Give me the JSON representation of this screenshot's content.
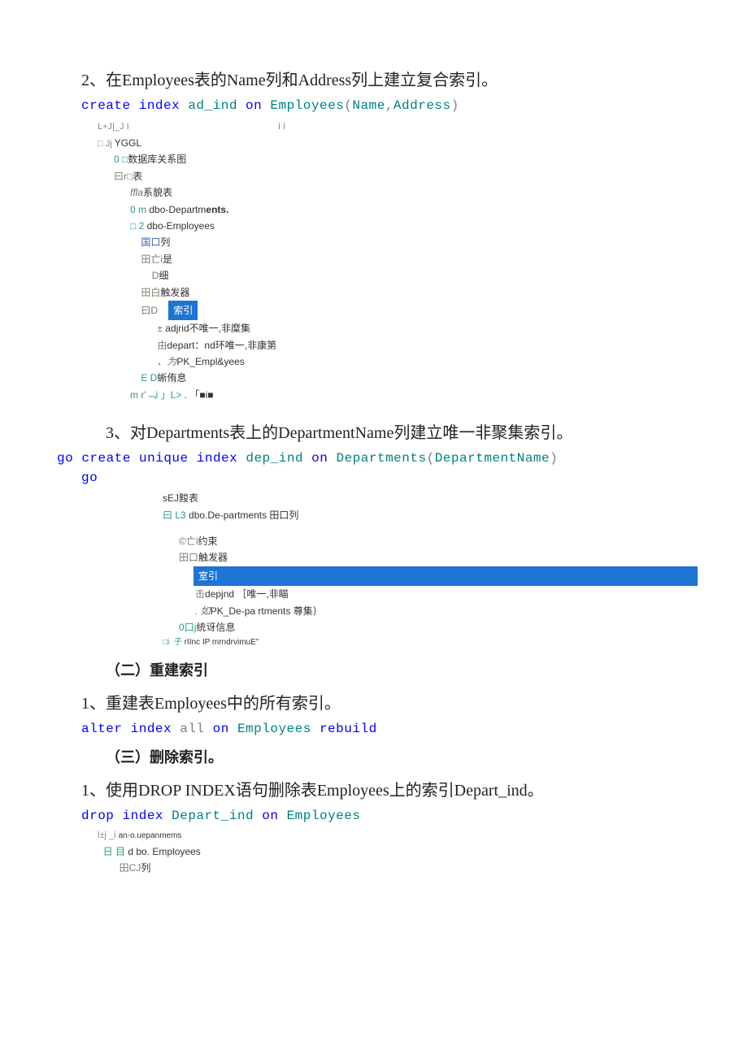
{
  "s2": {
    "title": "2、在Employees表的Name列和Address列上建立复合索引。",
    "code": {
      "create": "create index ",
      "idx": "ad_ind ",
      "on": "on ",
      "tbl": "Employees",
      "open": "(",
      "c1": "Name",
      "comma": ",",
      "c2": "Address",
      "close": ")"
    },
    "tree": {
      "r0": "L+J|_J I",
      "r0b": "I I",
      "r1_prefix": "□ Jj ",
      "r1": "YGGL",
      "r2_prefix": "0 □",
      "r2": "数据库关系图",
      "r3_prefix": "曰r□",
      "r3": "表",
      "r4_prefix": "fflа",
      "r4": "系貌表",
      "r5_prefix": "0 m ",
      "r5": "dbo-Departm",
      "r5b": "ents.",
      "r6_prefix": "□ 2 ",
      "r6": "dbo-Employees",
      "r7_prefix": "国口",
      "r7": "列",
      "r8_prefix": "田亡і",
      "r8": "是",
      "r9_prefix": "D",
      "r9": "细",
      "r10_prefix": "田白",
      "r10": "触发器",
      "r11_prefix": "曰D",
      "r11": "索引",
      "r12_prefix": "± ",
      "r12": "adjrid不唯一,非糜集",
      "r13_prefix": "由",
      "r13": "depart：nd环唯一,非康第",
      "r14_prefix": "、为",
      "r14": "PK_Empl&yees",
      "r15_prefix": "E D",
      "r15": "蜥侑息",
      "r16_prefix": "m r'﹁і 」L>",
      "r16": " . 「■і■"
    }
  },
  "s3": {
    "title": "3、对Departments表上的DepartmentName列建立唯一非聚集索引。",
    "code": {
      "go1": "go ",
      "create": "create unique index ",
      "idx": "dep_ind ",
      "on": "on ",
      "tbl": "Departments",
      "open": "(",
      "c1": "DepartmentName",
      "close": ")",
      "go2": "go"
    },
    "tree": {
      "r1": "sEJ黢表",
      "r2_prefix": "曰 L3 ",
      "r2": "dbo.De-partments 田口列",
      "r3_prefix": "©亡i",
      "r3": "约束",
      "r4_prefix": "田口",
      "r4": "触发器",
      "r5": "室引",
      "r6_prefix": "击",
      "r6": "depjnd ［唯一,非瞄",
      "r7_prefix": ". 如",
      "r7": "PK_De-pa rtments 尊集）",
      "r8_prefix": "0口j",
      "r8": "统讶信息",
      "r9_prefix": "□i  子",
      "r9": " rIInc IP mrndrvimuE\""
    }
  },
  "ssRebuild": {
    "heading": "（二）重建索引",
    "title": "1、重建表Employees中的所有索引。",
    "code": {
      "alter": "alter index ",
      "all": "all ",
      "on": "on ",
      "tbl": "Employees ",
      "rebuild": "rebuild"
    }
  },
  "ssDrop": {
    "heading": "（三）删除索引。",
    "title": "1、使用DROP INDEX语句删除表Employees上的索引Depart_ind。",
    "code": {
      "drop": "drop index ",
      "idx": "Depart_ind ",
      "on": "on ",
      "tbl": "Employees"
    },
    "tree": {
      "r1_prefix": "l±j _i ",
      "r1": "an-o.uepanmems",
      "r2_prefix": "日 目 ",
      "r2": "d bo. Employees",
      "r3_prefix": "田CJ",
      "r3": "列"
    }
  }
}
